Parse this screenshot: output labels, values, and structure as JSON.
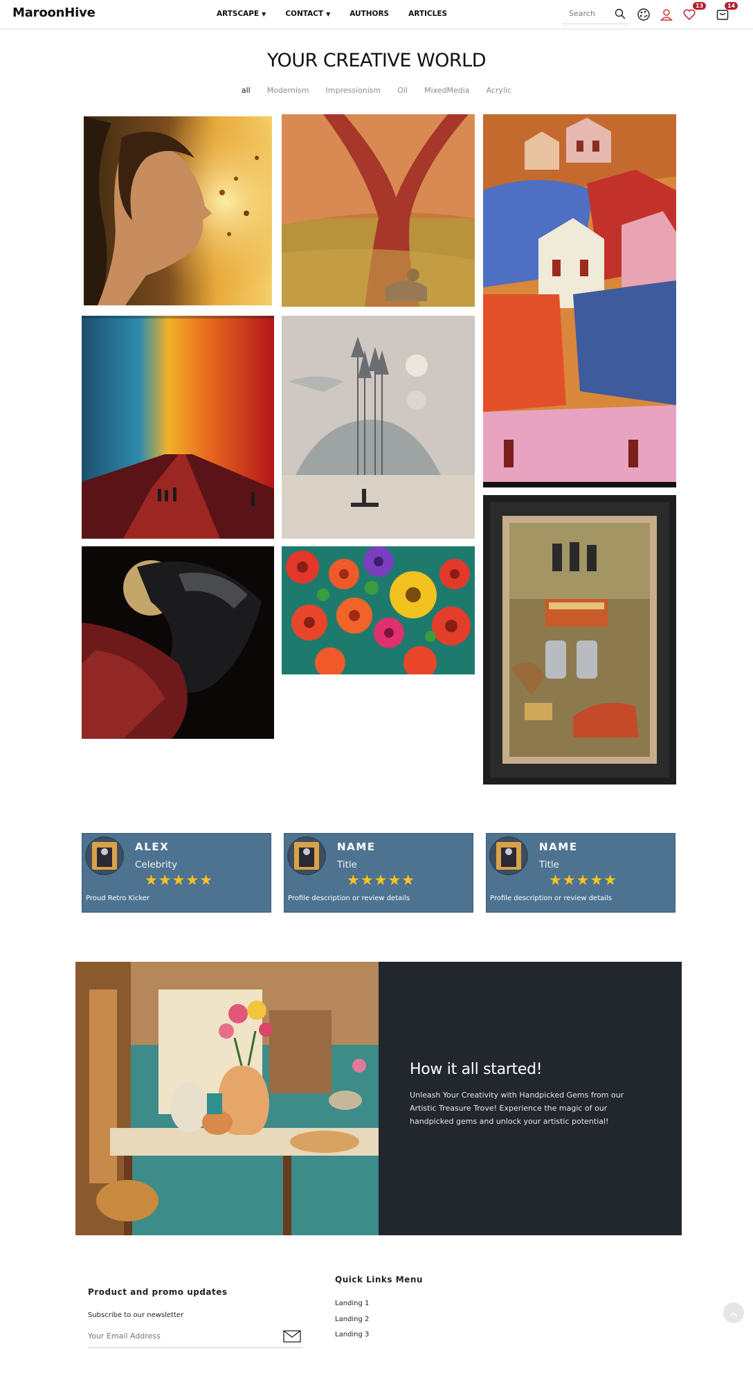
{
  "header": {
    "logo": "MaroonHive",
    "nav": [
      {
        "label": "ARTSCAPE",
        "has_dropdown": true
      },
      {
        "label": "CONTACT",
        "has_dropdown": true
      },
      {
        "label": "AUTHORS",
        "has_dropdown": false
      },
      {
        "label": "ARTICLES",
        "has_dropdown": false
      }
    ],
    "search_placeholder": "Search",
    "icons": [
      "palette-icon",
      "user-icon",
      "heart-icon",
      "cart-icon"
    ],
    "wishlist_count": "13",
    "cart_count": "14",
    "badge_color": "#b51e2a"
  },
  "gallery": {
    "title": "YOUR CREATIVE WORLD",
    "filters": [
      "all",
      "Modernism",
      "Impressionism",
      "Oil",
      "MixedMedia",
      "Acrylic"
    ],
    "active_filter": "all",
    "artworks": [
      {
        "subject": "woman-blowing-golden-petals"
      },
      {
        "subject": "figure-resting-under-red-tree"
      },
      {
        "subject": "colorful-houses-cubist"
      },
      {
        "subject": "colorful-alley-city"
      },
      {
        "subject": "misty-lake-pine-trees-boat"
      },
      {
        "subject": "dark-winged-figure-moon"
      },
      {
        "subject": "flower-field-zinnias"
      },
      {
        "subject": "framed-toys-robots-painting"
      }
    ]
  },
  "reviews": [
    {
      "name": "ALEX",
      "role": "Celebrity",
      "stars": 5,
      "stars_text": "★★★★★",
      "desc": "Proud Retro Kicker"
    },
    {
      "name": "NAME",
      "role": "Title",
      "stars": 5,
      "stars_text": "★★★★★",
      "desc": "Profile description or review details"
    },
    {
      "name": "NAME",
      "role": "Title",
      "stars": 5,
      "stars_text": "★★★★★",
      "desc": "Profile description or review details"
    }
  ],
  "story": {
    "title": "How it all started!",
    "text": "Unleash Your Creativity with Handpicked Gems from our Artistic Treasure Trove! Experience the magic of our handpicked gems and unlock your artistic potential!"
  },
  "footer": {
    "newsletter_heading": "Product and promo updates",
    "newsletter_sub": "Subscribe to our newsletter",
    "email_placeholder": "Your Email Address",
    "links_heading": "Quick Links Menu",
    "links": [
      "Landing 1",
      "Landing 2",
      "Landing 3"
    ]
  },
  "colors": {
    "card_bg": "#4e7391",
    "story_bg": "#22262d",
    "star": "#f7c51c"
  }
}
